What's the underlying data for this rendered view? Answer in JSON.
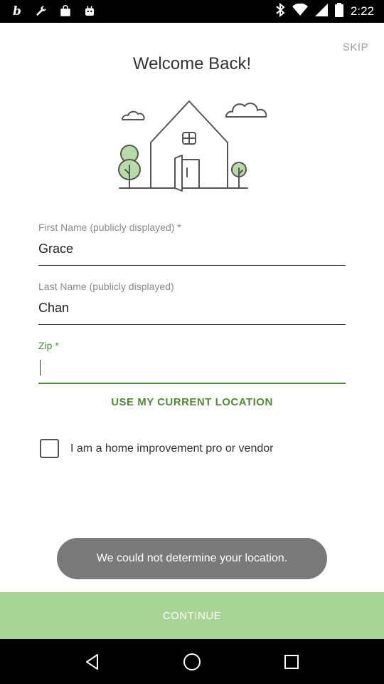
{
  "status_bar": {
    "time": "2:22",
    "left_icons": [
      "bold-b-icon",
      "wrench-icon",
      "bag-icon",
      "robot-icon"
    ],
    "right_icons": [
      "bluetooth-icon",
      "wifi-icon",
      "signal-icon",
      "battery-icon"
    ]
  },
  "header": {
    "skip_label": "SKIP",
    "title": "Welcome Back!"
  },
  "form": {
    "first_name": {
      "label": "First Name (publicly displayed) *",
      "value": "Grace"
    },
    "last_name": {
      "label": "Last Name (publicly displayed)",
      "value": "Chan"
    },
    "zip": {
      "label": "Zip *",
      "value": ""
    },
    "location_link": "USE MY CURRENT LOCATION",
    "pro_checkbox_label": "I am a home improvement pro or vendor",
    "pro_checked": false
  },
  "toast": {
    "message": "We could not determine your location."
  },
  "footer": {
    "continue_label": "CONTINUE"
  },
  "colors": {
    "accent": "#4d8b35",
    "continue_bg": "#a8d596",
    "toast_bg": "#7a7a7a"
  }
}
